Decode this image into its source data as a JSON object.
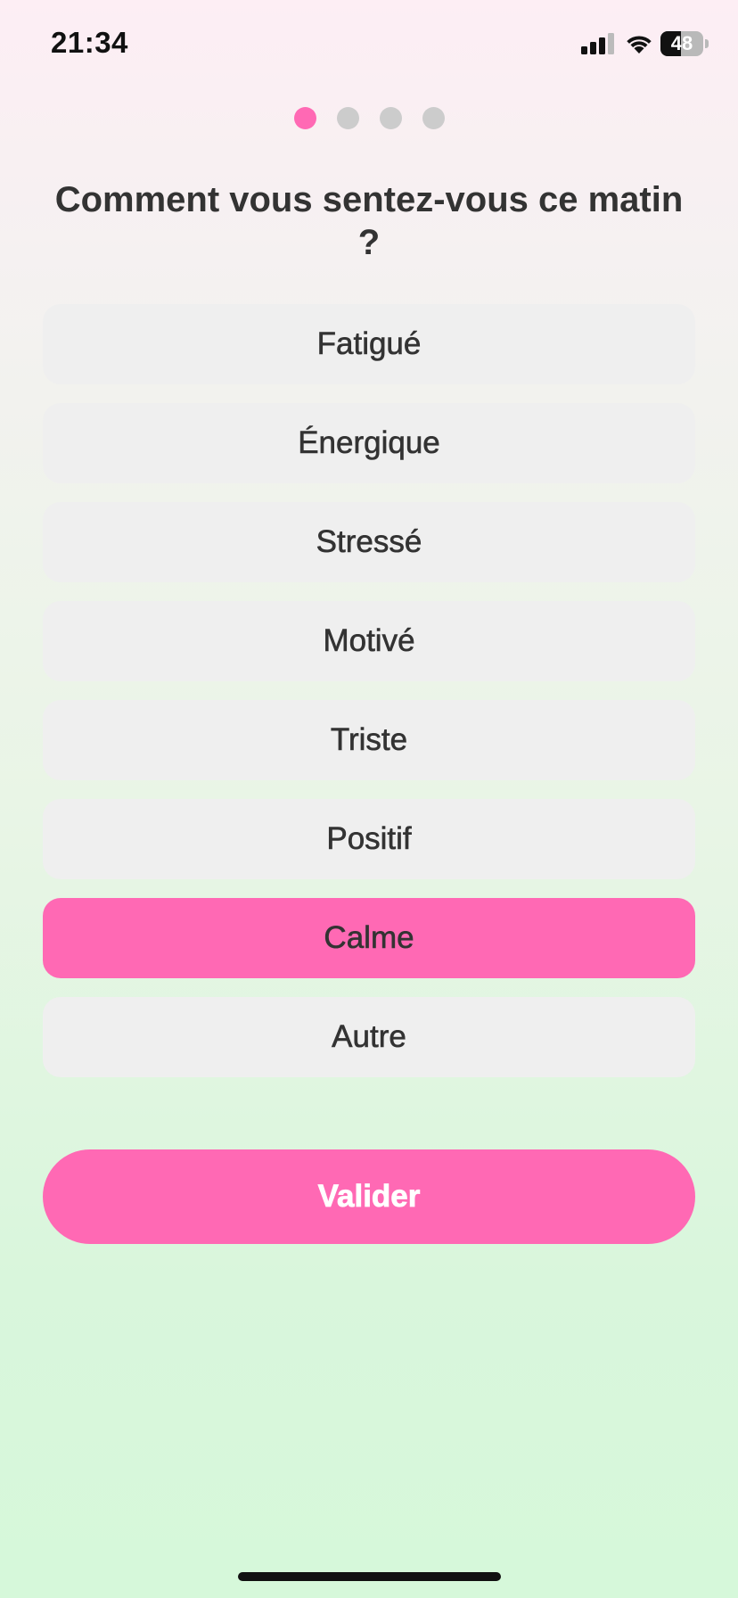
{
  "status_bar": {
    "time": "21:34",
    "battery_level": "48",
    "battery_fraction": 0.48,
    "signal_icon": "cellular-signal-icon",
    "wifi_icon": "wifi-icon",
    "battery_icon": "battery-icon"
  },
  "progress": {
    "total_steps": 4,
    "current_step": 1
  },
  "question": {
    "title": "Comment vous sentez-vous ce matin ?"
  },
  "options": [
    {
      "label": "Fatigué",
      "selected": false
    },
    {
      "label": "Énergique",
      "selected": false
    },
    {
      "label": "Stressé",
      "selected": false
    },
    {
      "label": "Motivé",
      "selected": false
    },
    {
      "label": "Triste",
      "selected": false
    },
    {
      "label": "Positif",
      "selected": false
    },
    {
      "label": "Calme",
      "selected": true
    },
    {
      "label": "Autre",
      "selected": false
    }
  ],
  "validate_button": {
    "label": "Valider"
  },
  "colors": {
    "accent": "#ff69b4",
    "option_background": "#efefef",
    "text": "#333333",
    "inactive_dot": "#cccccc"
  }
}
